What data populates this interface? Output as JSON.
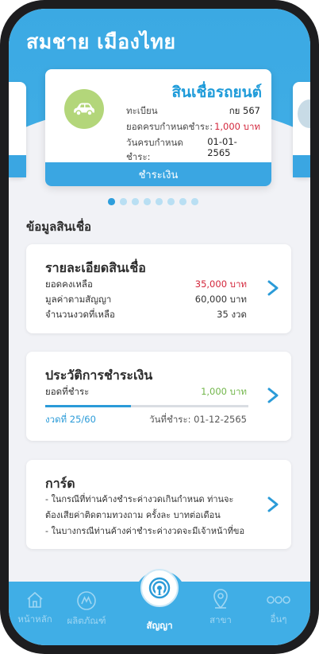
{
  "user": {
    "name": "สมชาย  เมืองไทย"
  },
  "loan_card": {
    "title": "สินเชื่อรถยนต์",
    "icon": "car-icon",
    "rows": [
      {
        "label": "ทะเบียน",
        "value": "กย 567"
      },
      {
        "label": "ยอดครบกำหนดชำระ:",
        "value": "1,000 บาท"
      },
      {
        "label": "วันครบกำหนดชำระ:",
        "value": "01-01-2565"
      }
    ],
    "pay_label": "ชำระเงิน"
  },
  "carousel": {
    "total_pages": 8,
    "active_index": 0
  },
  "section": {
    "title": "ข้อมูลสินเชื่อ"
  },
  "details_card": {
    "title": "รายละเอียดสินเชื่อ",
    "rows": [
      {
        "label": "ยอดคงเหลือ",
        "value": "35,000 บาท"
      },
      {
        "label": "มูลค่าตามสัญญา",
        "value": "60,000 บาท"
      },
      {
        "label": "จำนวนงวดที่เหลือ",
        "value": "35 งวด"
      }
    ]
  },
  "history_card": {
    "title": "ประวัติการชำระเงิน",
    "paid_label": "ยอดที่ชำระ",
    "paid_value": "1,000 บาท",
    "installment": "งวดที่ 25/60",
    "payment_date": "วันที่ชำระ: 01-12-2565",
    "progress_fraction": 0.42
  },
  "card_info": {
    "title": "การ์ด",
    "lines": [
      "- ในกรณีที่ท่านค้างชำระค่างวดเกินกำหนด ท่านจะ",
      "ต้องเสียค่าติดตามทวงถาม ครั้งละ     บาทต่อเดือน",
      "- ในบางกรณีท่านค้างค่าชำระค่างวดจะมีเจ้าหน้าที่ขอ"
    ]
  },
  "tabbar": {
    "tabs": [
      {
        "label": "หน้าหลัก",
        "icon": "home-icon"
      },
      {
        "label": "ผลิตภัณฑ์",
        "icon": "product-icon"
      },
      {
        "label": "สัญญา",
        "icon": "contract-icon"
      },
      {
        "label": "สาขา",
        "icon": "location-icon"
      },
      {
        "label": "อื่นๆ",
        "icon": "more-icon"
      }
    ],
    "active_index": 2
  },
  "colors": {
    "primary": "#40aee6",
    "accent_blue": "#1e9bd9",
    "red": "#d3263b",
    "green": "#72b64a",
    "car_badge": "#b3d67a"
  }
}
